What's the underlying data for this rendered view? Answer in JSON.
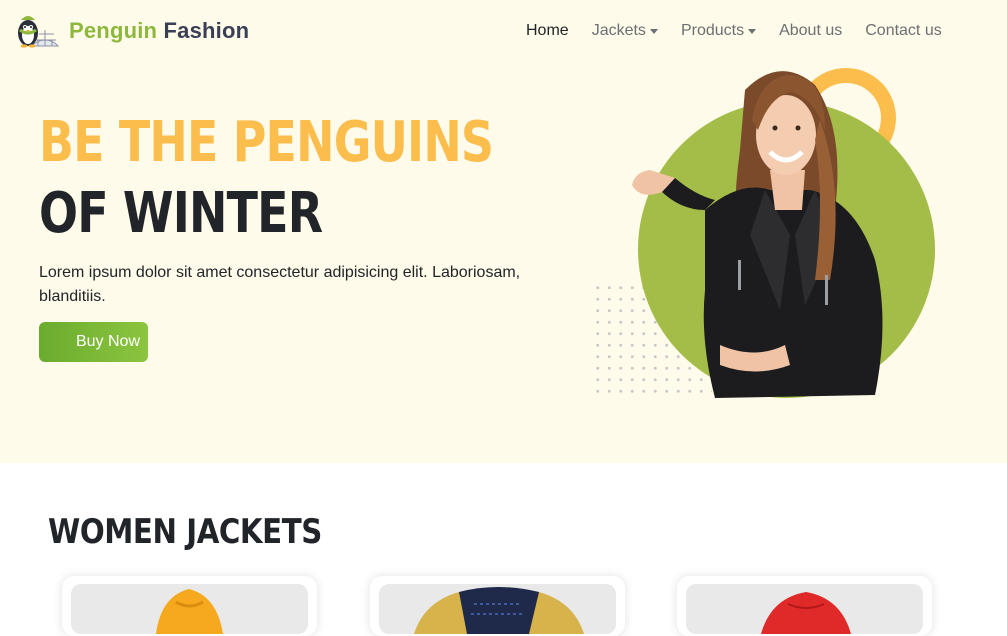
{
  "brand": {
    "name_part1": "Penguin",
    "name_part2": "Fashion",
    "logo_icon": "penguin-igloo-logo"
  },
  "nav": {
    "items": [
      {
        "label": "Home",
        "active": true
      },
      {
        "label": "Jackets",
        "dropdown": true
      },
      {
        "label": "Products",
        "dropdown": true
      },
      {
        "label": "About us"
      },
      {
        "label": "Contact us"
      }
    ]
  },
  "hero": {
    "title_line1": "BE THE PENGUINS",
    "title_line2": "OF WINTER",
    "lead": "Lorem ipsum dolor sit amet consectetur adipisicing elit. Laboriosam, blanditiis.",
    "button_label": "Buy Now",
    "image_name": "woman-in-leather-jacket"
  },
  "section": {
    "title": "WOMEN JACKETS",
    "cards": [
      {
        "image_name": "yellow-jacket",
        "color": "#f6a81e"
      },
      {
        "image_name": "navy-patterned-jacket",
        "color": "#1f2a4a"
      },
      {
        "image_name": "red-jacket",
        "color": "#e02a2a"
      }
    ]
  },
  "colors": {
    "accent_yellow": "#fbbd4c",
    "accent_green": "#8db83c",
    "hero_bg": "#fffbea",
    "dark": "#212529"
  }
}
